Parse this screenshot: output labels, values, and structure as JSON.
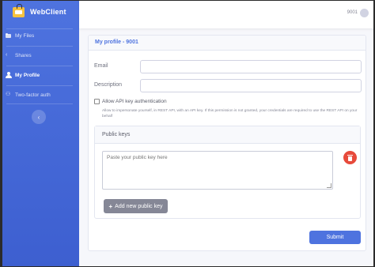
{
  "brand": {
    "name": "WebClient"
  },
  "sidebar": {
    "items": [
      {
        "label": "My Files",
        "icon": "folder-icon"
      },
      {
        "label": "Shares",
        "icon": "share-icon"
      },
      {
        "label": "My Profile",
        "icon": "user-icon",
        "active": true
      },
      {
        "label": "Two-factor auth",
        "icon": "users-icon"
      }
    ],
    "toggle_glyph": "‹"
  },
  "topbar": {
    "user_name": "9001"
  },
  "profile": {
    "title": "My profile - 9001",
    "email_label": "Email",
    "email_value": "",
    "description_label": "Description",
    "description_value": "",
    "allow_api_key_label": "Allow API key authentication",
    "allow_api_key_checked": false,
    "api_key_help": "Allow to impersonate yourself, in REST API, with an API key. If this permission is not granted, your credentials are required to use the REST API on your behalf",
    "public_keys": {
      "title": "Public keys",
      "textarea_placeholder": "Paste your public key here",
      "add_label": "Add new public key"
    },
    "submit_label": "Submit"
  },
  "colors": {
    "primary": "#4e73df",
    "danger": "#e74a3b",
    "secondary": "#858796"
  }
}
